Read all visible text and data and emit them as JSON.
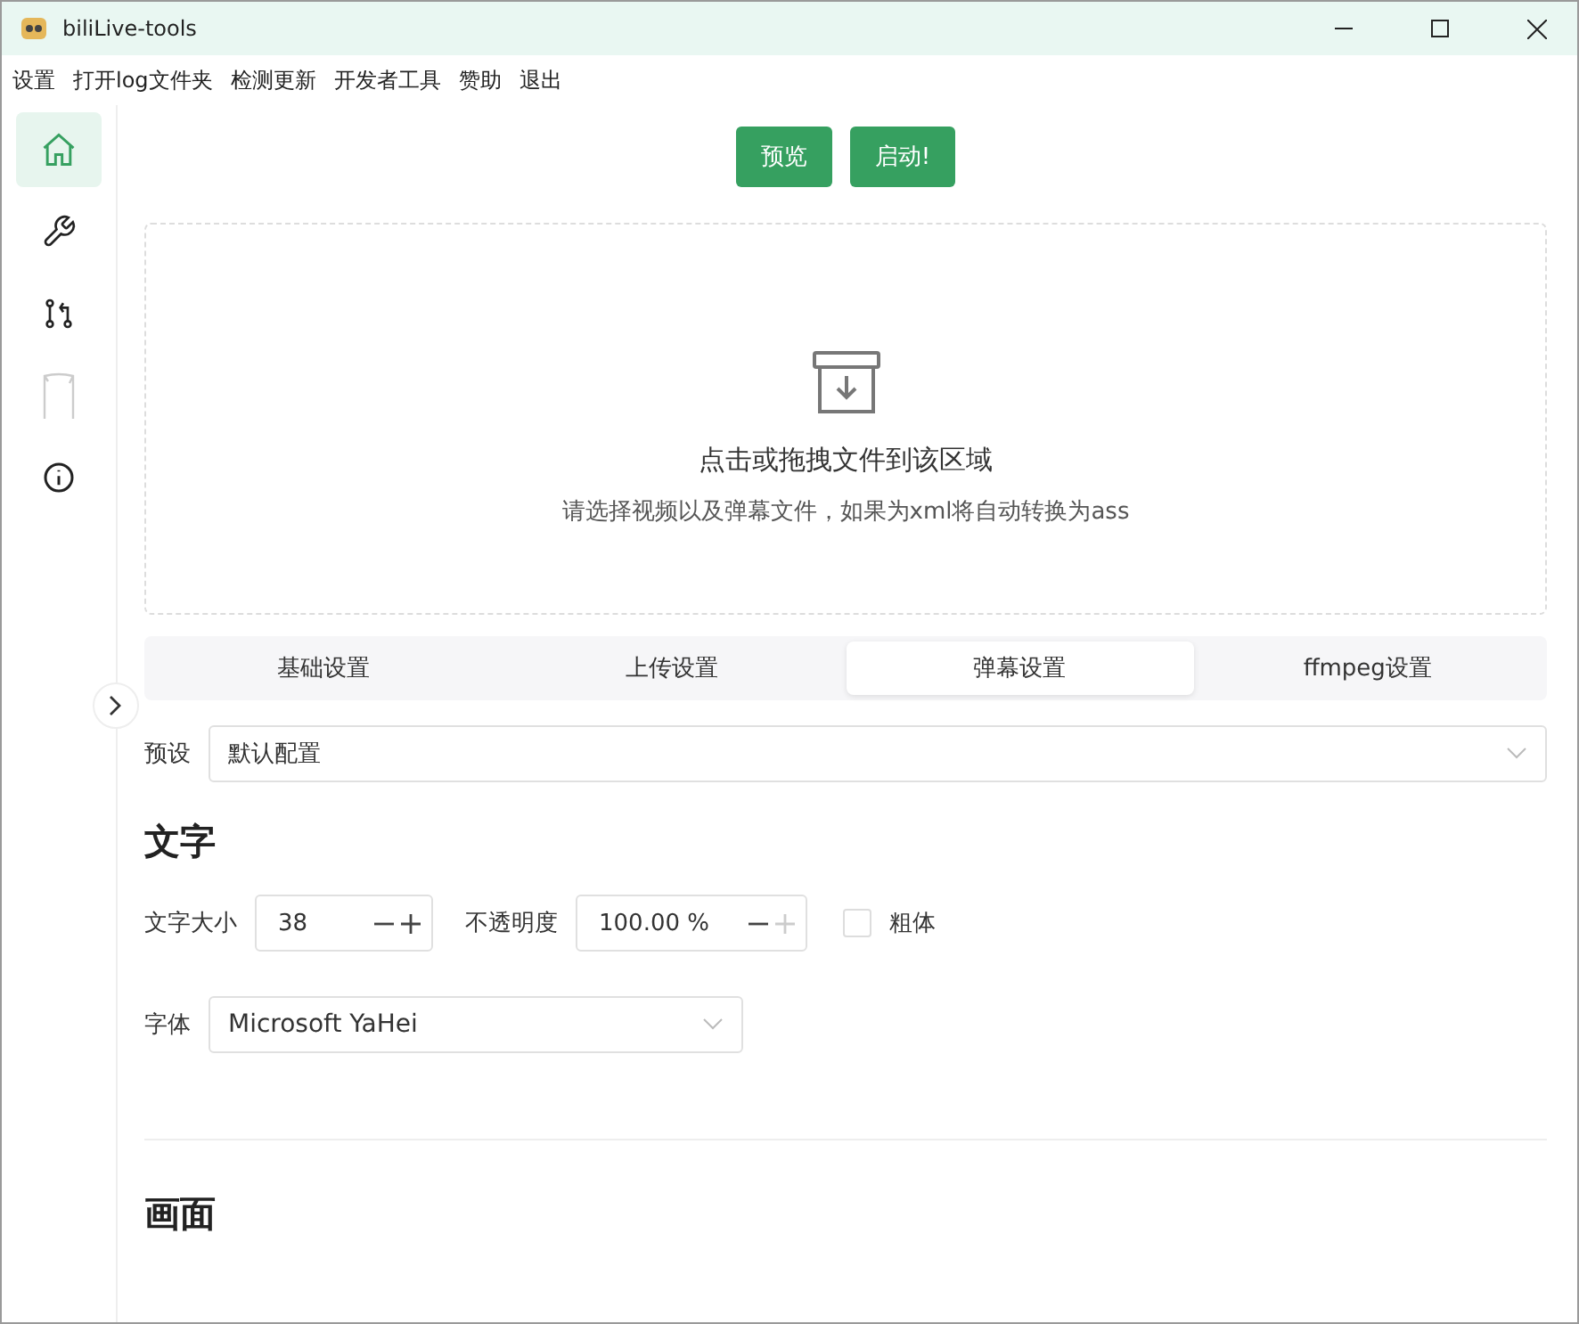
{
  "window": {
    "title": "biliLive-tools"
  },
  "menu": [
    "设置",
    "打开log文件夹",
    "检测更新",
    "开发者工具",
    "赞助",
    "退出"
  ],
  "sidebar": {
    "items": [
      {
        "kind": "home",
        "selected": true,
        "disabled": false
      },
      {
        "kind": "wrench",
        "selected": false,
        "disabled": false
      },
      {
        "kind": "merge",
        "selected": false,
        "disabled": false
      },
      {
        "kind": "figure",
        "selected": false,
        "disabled": true
      },
      {
        "kind": "info",
        "selected": false,
        "disabled": false
      }
    ]
  },
  "actions": [
    "预览",
    "启动!"
  ],
  "dropzone": {
    "title": "点击或拖拽文件到该区域",
    "hint": "请选择视频以及弹幕文件，如果为xml将自动转换为ass"
  },
  "tabs": [
    {
      "label": "基础设置",
      "selected": false
    },
    {
      "label": "上传设置",
      "selected": false
    },
    {
      "label": "弹幕设置",
      "selected": true
    },
    {
      "label": "ffmpeg设置",
      "selected": false
    }
  ],
  "preset": {
    "label": "预设",
    "value": "默认配置"
  },
  "text_section": {
    "heading": "文字",
    "font_size": {
      "label": "文字大小",
      "value": "38",
      "minus_disabled": false,
      "plus_disabled": false
    },
    "opacity": {
      "label": "不透明度",
      "value": "100.00",
      "unit": "%",
      "minus_disabled": false,
      "plus_disabled": true
    },
    "bold": {
      "label": "粗体",
      "checked": false
    },
    "font": {
      "label": "字体",
      "value": "Microsoft YaHei"
    }
  },
  "picture_section": {
    "heading": "画面"
  }
}
